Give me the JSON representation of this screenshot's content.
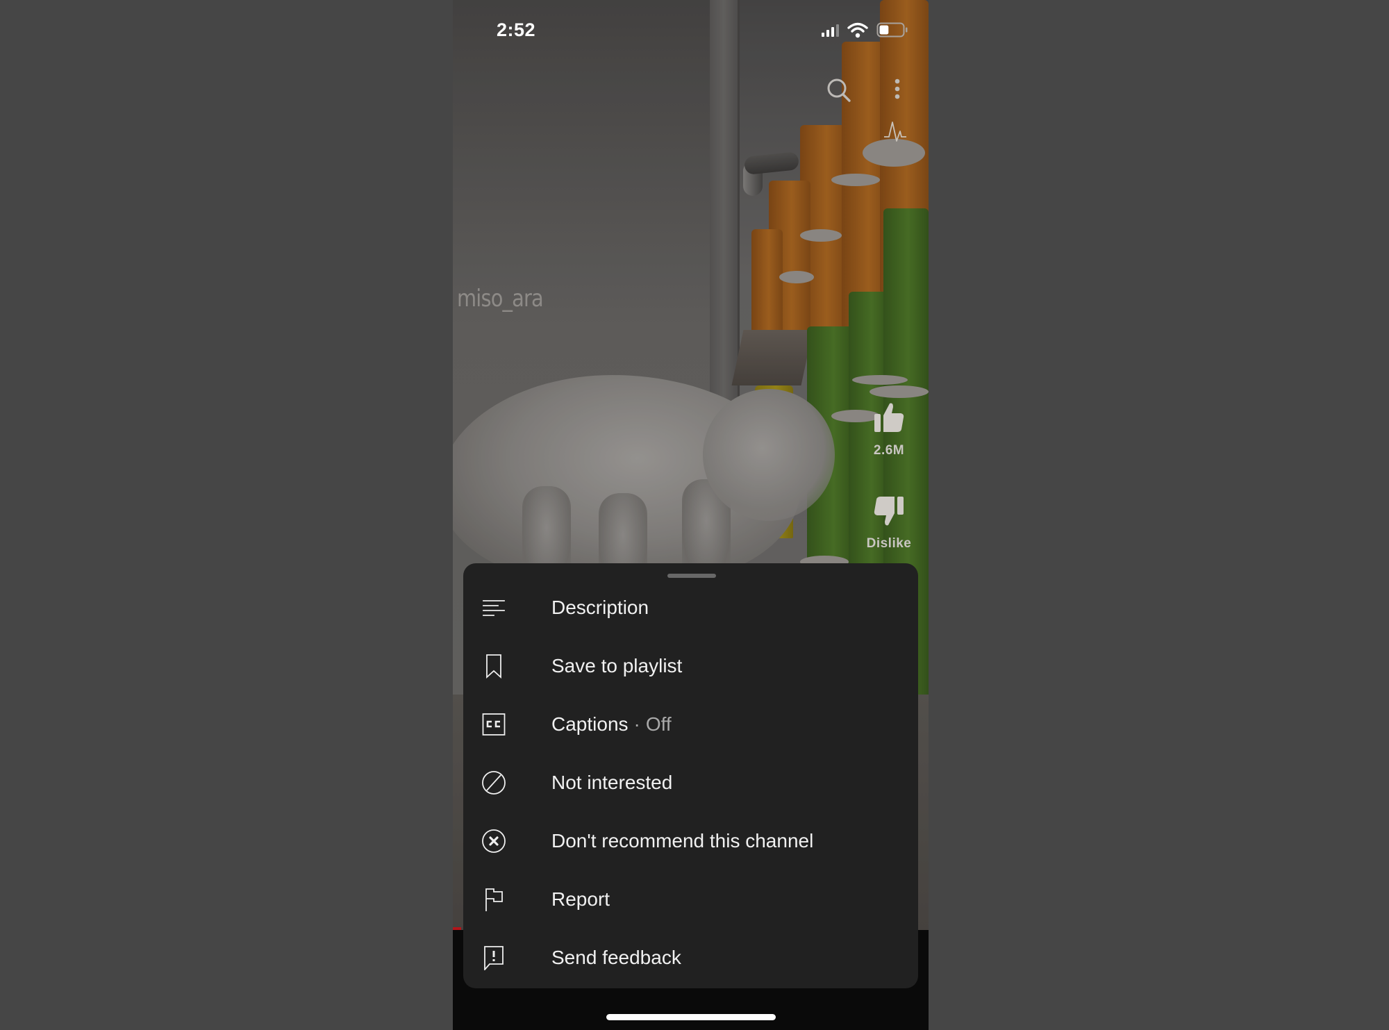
{
  "status_bar": {
    "time": "2:52",
    "signal_icon": "cellular-signal-icon",
    "wifi_icon": "wifi-icon",
    "battery_icon": "battery-icon",
    "battery_level": 0.4
  },
  "video": {
    "watermark": "miso_ara",
    "progress": 0.0,
    "top_actions": [
      {
        "name": "search-icon"
      },
      {
        "name": "more-options-icon"
      },
      {
        "name": "pulse-icon"
      }
    ],
    "side_actions": {
      "like_count": "2.6M",
      "dislike_label": "Dislike"
    }
  },
  "sheet": {
    "items": [
      {
        "icon": "description-icon",
        "label": "Description"
      },
      {
        "icon": "bookmark-icon",
        "label": "Save to playlist"
      },
      {
        "icon": "captions-icon",
        "label": "Captions",
        "separator": "·",
        "sub": "Off"
      },
      {
        "icon": "not-interested-icon",
        "label": "Not interested"
      },
      {
        "icon": "dont-recommend-icon",
        "label": "Don't recommend this channel"
      },
      {
        "icon": "flag-icon",
        "label": "Report"
      },
      {
        "icon": "feedback-icon",
        "label": "Send feedback"
      }
    ]
  },
  "colors": {
    "sheet_bg": "#212121",
    "text": "#f1f1f1",
    "secondary_text": "#a9a9a9",
    "progress_red": "#b3151a"
  }
}
